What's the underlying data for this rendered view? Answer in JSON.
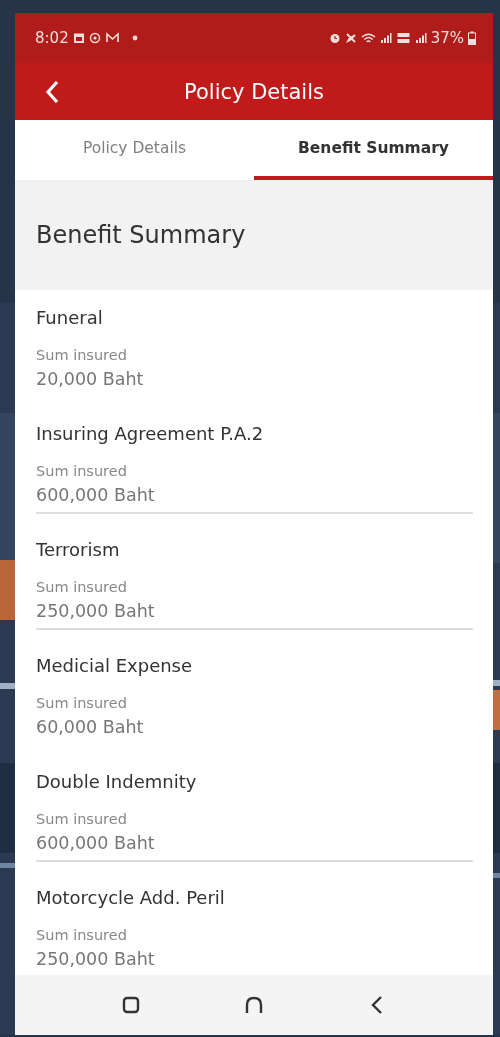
{
  "status_bar": {
    "time": "8:02",
    "battery": "37%"
  },
  "header": {
    "title": "Policy Details"
  },
  "tabs": [
    {
      "label": "Policy Details",
      "selected": false
    },
    {
      "label": "Benefit Summary",
      "selected": true
    }
  ],
  "section": {
    "title": "Benefit Summary"
  },
  "benefits": [
    {
      "name": "Funeral",
      "label": "Sum insured",
      "value": "20,000 Baht",
      "divider": false
    },
    {
      "name": "Insuring Agreement P.A.2",
      "label": "Sum insured",
      "value": "600,000 Baht",
      "divider": true
    },
    {
      "name": "Terrorism",
      "label": "Sum insured",
      "value": "250,000 Baht",
      "divider": true
    },
    {
      "name": "Medicial Expense",
      "label": "Sum insured",
      "value": "60,000 Baht",
      "divider": false
    },
    {
      "name": "Double Indemnity",
      "label": "Sum insured",
      "value": "600,000 Baht",
      "divider": true
    },
    {
      "name": "Motorcycle Add. Peril",
      "label": "Sum insured",
      "value": "250,000 Baht",
      "divider": false
    }
  ]
}
